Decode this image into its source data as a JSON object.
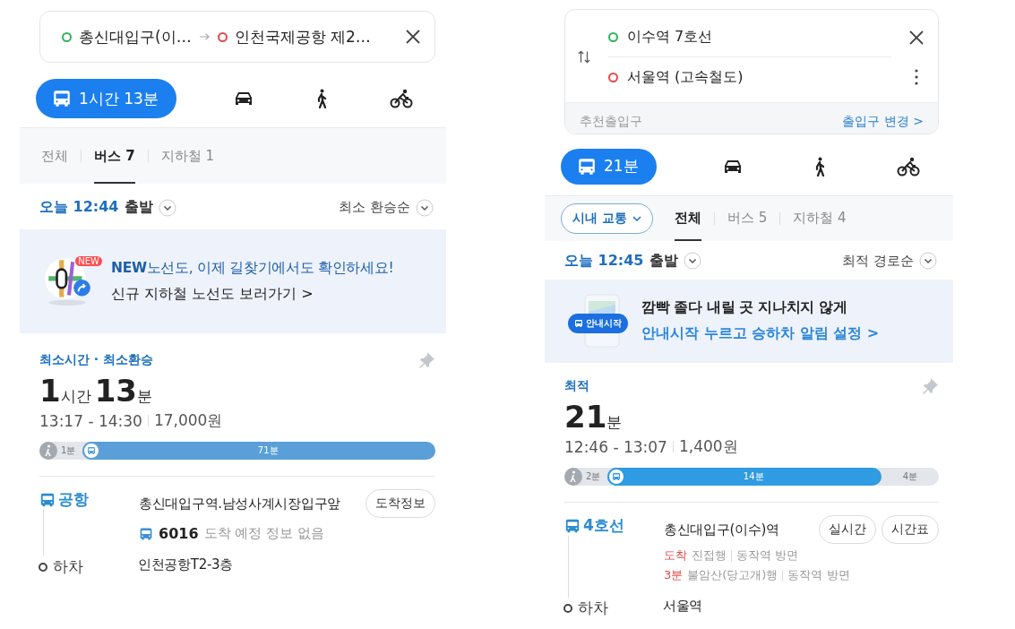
{
  "panels": [
    {
      "search": {
        "kind": "single",
        "origin": "총신대입구(이…",
        "destination": "인천국제공항 제2…"
      },
      "modes": [
        {
          "kind": "transit",
          "label": "1시간 13분",
          "selected": true
        },
        {
          "kind": "car",
          "selected": false
        },
        {
          "kind": "walk",
          "selected": false
        },
        {
          "kind": "bike",
          "selected": false
        }
      ],
      "tabs": [
        {
          "label": "전체",
          "selected": false
        },
        {
          "label": "버스 7",
          "selected": true
        },
        {
          "label": "지하철 1",
          "selected": false
        }
      ],
      "depart": {
        "time": "오늘 12:44",
        "label": "출발",
        "sort": "최소 환승순"
      },
      "banner": {
        "kind": "map",
        "icon_badge": "NEW",
        "highlight": "NEW",
        "title": "노선도, 이제 길찾기에서도 확인하세요!",
        "link": "신규 지하철 노선도 보러가기 >"
      },
      "route": {
        "tag": "최소시간 · 최소환승",
        "duration": [
          {
            "value": "1",
            "unit": "시간"
          },
          {
            "value": "13",
            "unit": "분"
          }
        ],
        "times": "13:17 - 14:30",
        "fare": "17,000원",
        "segments": [
          {
            "kind": "walk",
            "label": "1분"
          },
          {
            "kind": "bus",
            "label": "71분",
            "color": "#5a9fd8"
          }
        ],
        "steps": [
          {
            "kind": "board",
            "line": "공항",
            "stop": "총신대입구역.남성사계시장입구앞",
            "buttons": [
              "도착정보"
            ],
            "arrivals": [
              {
                "kind": "bus",
                "route": "6016",
                "status": "도착 예정 정보 없음"
              }
            ]
          },
          {
            "kind": "alight",
            "line": "하차",
            "stop": "인천공항T2-3층"
          }
        ]
      }
    },
    {
      "search": {
        "kind": "double",
        "origin": "이수역 7호선",
        "destination": "서울역 (고속철도)",
        "entrance_label": "추천출입구",
        "entrance_link": "출입구 변경 >"
      },
      "modes": [
        {
          "kind": "transit",
          "label": "21분",
          "selected": true
        },
        {
          "kind": "car",
          "selected": false
        },
        {
          "kind": "walk",
          "selected": false
        },
        {
          "kind": "bike",
          "selected": false
        }
      ],
      "filter": "시내 교통",
      "tabs": [
        {
          "label": "전체",
          "selected": true
        },
        {
          "label": "버스 5",
          "selected": false
        },
        {
          "label": "지하철 4",
          "selected": false
        }
      ],
      "depart": {
        "time": "오늘 12:45",
        "label": "출발",
        "sort": "최적 경로순"
      },
      "banner": {
        "kind": "phone",
        "icon_badge": "안내시작",
        "title": "깜빡 졸다 내릴 곳 지나치지 않게",
        "link": "안내시작 누르고 승하차 알림 설정 >"
      },
      "route": {
        "tag": "최적",
        "duration": [
          {
            "value": "21",
            "unit": "분"
          }
        ],
        "times": "12:46 - 13:07",
        "fare": "1,400원",
        "segments": [
          {
            "kind": "walk",
            "label": "2분"
          },
          {
            "kind": "subway",
            "label": "14분",
            "color": "#2f9be2"
          },
          {
            "kind": "walk",
            "label": "4분"
          }
        ],
        "steps": [
          {
            "kind": "board",
            "line": "4호선",
            "stop": "총신대입구(이수)역",
            "buttons": [
              "실시간",
              "시간표"
            ],
            "arrivals": [
              {
                "kind": "train",
                "eta": "도착",
                "destination": "진접행",
                "direction": "동작역 방면"
              },
              {
                "kind": "train",
                "eta": "3분",
                "destination": "불암산(당고개)행",
                "direction": "동작역 방면"
              }
            ]
          },
          {
            "kind": "alight",
            "line": "하차",
            "stop": "서울역"
          }
        ]
      }
    }
  ]
}
